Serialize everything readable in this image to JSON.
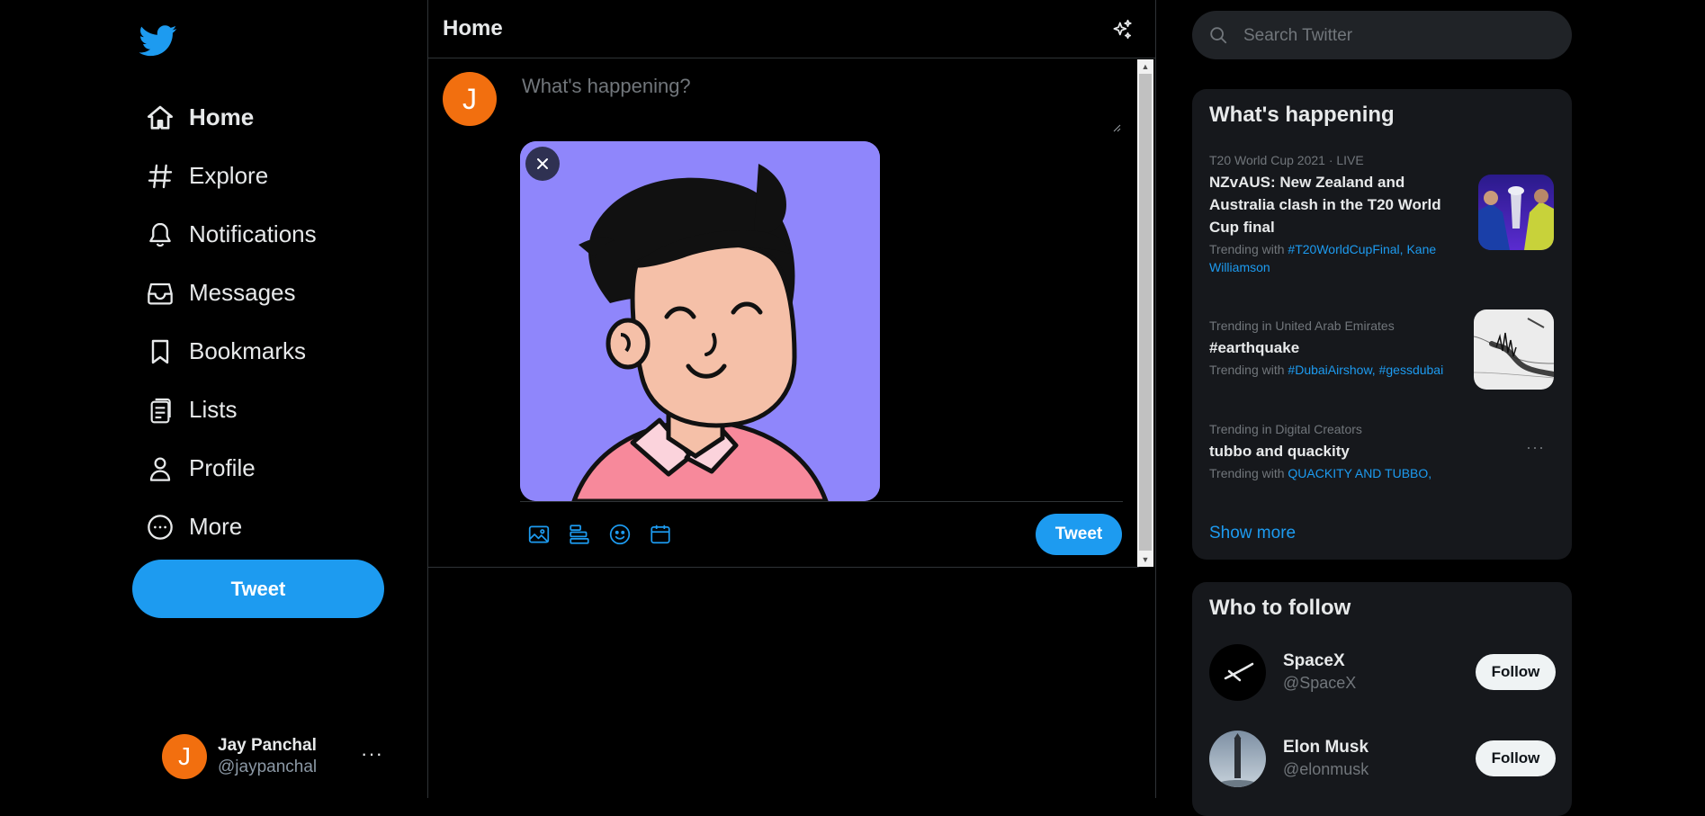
{
  "colors": {
    "accent": "#1d9bf0",
    "background": "#000000",
    "panel": "#16181c",
    "avatar_orange": "#f26f0f",
    "muted_text": "#71767b"
  },
  "sidebar": {
    "logo_icon": "twitter-bird-icon",
    "nav": [
      {
        "label": "Home",
        "icon": "home-icon",
        "active": true
      },
      {
        "label": "Explore",
        "icon": "hashtag-icon"
      },
      {
        "label": "Notifications",
        "icon": "bell-icon"
      },
      {
        "label": "Messages",
        "icon": "inbox-icon"
      },
      {
        "label": "Bookmarks",
        "icon": "bookmark-icon"
      },
      {
        "label": "Lists",
        "icon": "list-icon"
      },
      {
        "label": "Profile",
        "icon": "person-icon"
      },
      {
        "label": "More",
        "icon": "more-circle-icon"
      }
    ],
    "tweet_button": "Tweet",
    "account": {
      "initial": "J",
      "name": "Jay Panchal",
      "handle": "@jaypanchal",
      "more": "···"
    }
  },
  "main": {
    "title": "Home",
    "composer": {
      "avatar_initial": "J",
      "placeholder": "What's happening?",
      "tools": [
        "image-icon",
        "poll-icon",
        "emoji-icon",
        "schedule-icon"
      ],
      "tweet_button": "Tweet"
    }
  },
  "right": {
    "search_placeholder": "Search Twitter",
    "trends": {
      "title": "What's happening",
      "items": [
        {
          "meta": "T20 World Cup 2021 · LIVE",
          "title": "NZvAUS: New Zealand and Australia clash in the T20 World Cup final",
          "with_prefix": "Trending with ",
          "with_tags": "#T20WorldCupFinal, Kane Williamson",
          "thumbnail": "cricket-final-image"
        },
        {
          "meta": "Trending in United Arab Emirates",
          "title": "#earthquake",
          "with_prefix": "Trending with ",
          "with_tags": "#DubaiAirshow, #gessdubai",
          "thumbnail": "earthquake-seismograph-image"
        },
        {
          "meta": "Trending in Digital Creators",
          "title": "tubbo and quackity",
          "with_prefix": "Trending with ",
          "with_tags": "QUACKITY AND TUBBO,",
          "more": "···"
        }
      ],
      "show_more": "Show more"
    },
    "who_to_follow": {
      "title": "Who to follow",
      "items": [
        {
          "name": "SpaceX",
          "handle": "@SpaceX",
          "button": "Follow"
        },
        {
          "name": "Elon Musk",
          "handle": "@elonmusk",
          "button": "Follow"
        }
      ]
    }
  }
}
